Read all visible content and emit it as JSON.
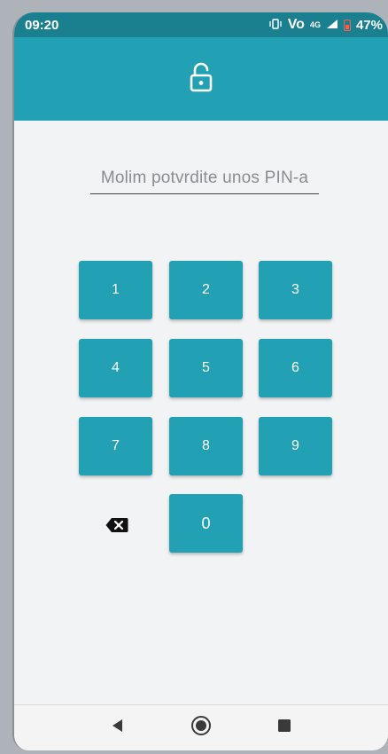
{
  "status_bar": {
    "time": "09:20",
    "signal_strength_label": "4G",
    "volte_label": "Vo",
    "battery": "47%",
    "icons": [
      "vibrate-icon",
      "volte-icon",
      "signal-icon",
      "battery-icon"
    ]
  },
  "header": {
    "icon": "unlock-icon",
    "background_color": "#22a0b4"
  },
  "pin_field": {
    "placeholder": "Molim potvrdite unos PIN-a"
  },
  "keypad": {
    "keys": [
      "1",
      "2",
      "3",
      "4",
      "5",
      "6",
      "7",
      "8",
      "9",
      "0"
    ],
    "backspace_icon": "backspace-icon",
    "key_color": "#22a0b4"
  },
  "nav_bar": {
    "buttons": [
      "back-icon",
      "home-icon",
      "recents-icon"
    ]
  }
}
